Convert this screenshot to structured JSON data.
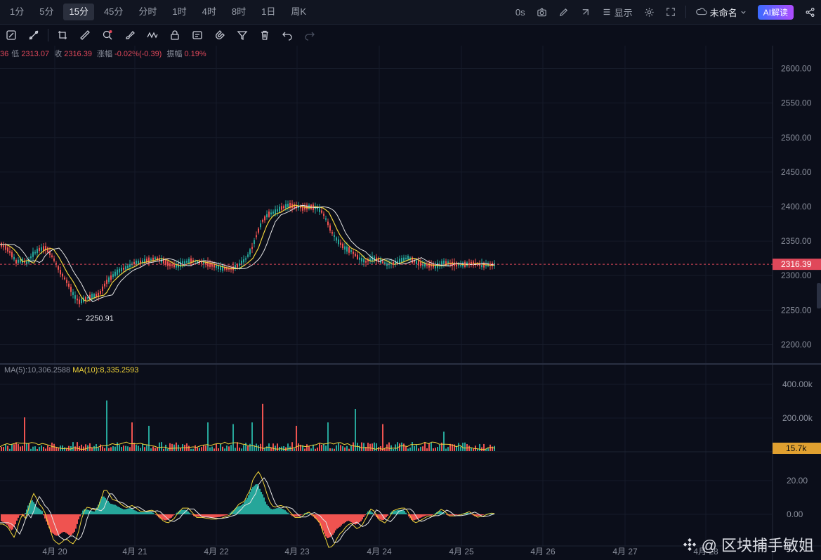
{
  "timeframes": [
    "1分",
    "5分",
    "15分",
    "45分",
    "分时",
    "1时",
    "4时",
    "8时",
    "1日",
    "周K"
  ],
  "active_timeframe": "15分",
  "toolbar_right": {
    "countdown": "0s",
    "display_label": "显示",
    "layout_name": "未命名",
    "ai_label": "AI解读"
  },
  "ohlc": {
    "prefix": "36",
    "low_label": "低",
    "low": "2313.07",
    "close_label": "收",
    "close": "2316.39",
    "change_label": "涨幅",
    "change": "-0.02%(-0.39)",
    "amp_label": "振幅",
    "amp": "0.19%"
  },
  "chart_data": {
    "type": "candlestick",
    "price_axis": {
      "ticks": [
        "2600.00",
        "2550.00",
        "2500.00",
        "2450.00",
        "2400.00",
        "2350.00",
        "2300.00",
        "2250.00",
        "2200.00"
      ],
      "range": [
        2175,
        2625
      ]
    },
    "current_price": "2316.39",
    "low_marker": "2250.91",
    "x_ticks": [
      "4月 20",
      "4月 21",
      "4月 22",
      "4月 23",
      "4月 24",
      "4月 25",
      "4月 26",
      "4月 27",
      "4月 28"
    ],
    "price_path": [
      [
        0,
        2345
      ],
      [
        8,
        2340
      ],
      [
        15,
        2332
      ],
      [
        22,
        2320
      ],
      [
        30,
        2322
      ],
      [
        38,
        2318
      ],
      [
        45,
        2330
      ],
      [
        55,
        2338
      ],
      [
        65,
        2340
      ],
      [
        75,
        2325
      ],
      [
        85,
        2305
      ],
      [
        95,
        2290
      ],
      [
        105,
        2270
      ],
      [
        112,
        2262
      ],
      [
        120,
        2266
      ],
      [
        130,
        2270
      ],
      [
        140,
        2272
      ],
      [
        150,
        2290
      ],
      [
        160,
        2300
      ],
      [
        170,
        2308
      ],
      [
        180,
        2312
      ],
      [
        190,
        2318
      ],
      [
        200,
        2320
      ],
      [
        210,
        2322
      ],
      [
        220,
        2325
      ],
      [
        230,
        2322
      ],
      [
        240,
        2316
      ],
      [
        250,
        2314
      ],
      [
        260,
        2318
      ],
      [
        270,
        2322
      ],
      [
        280,
        2320
      ],
      [
        290,
        2318
      ],
      [
        300,
        2315
      ],
      [
        310,
        2312
      ],
      [
        320,
        2310
      ],
      [
        330,
        2310
      ],
      [
        340,
        2316
      ],
      [
        350,
        2325
      ],
      [
        358,
        2340
      ],
      [
        365,
        2360
      ],
      [
        372,
        2378
      ],
      [
        380,
        2388
      ],
      [
        390,
        2392
      ],
      [
        400,
        2398
      ],
      [
        410,
        2402
      ],
      [
        420,
        2400
      ],
      [
        430,
        2398
      ],
      [
        440,
        2400
      ],
      [
        450,
        2398
      ],
      [
        458,
        2392
      ],
      [
        465,
        2378
      ],
      [
        472,
        2362
      ],
      [
        480,
        2350
      ],
      [
        490,
        2340
      ],
      [
        500,
        2335
      ],
      [
        510,
        2325
      ],
      [
        520,
        2320
      ],
      [
        530,
        2325
      ],
      [
        540,
        2322
      ],
      [
        550,
        2316
      ],
      [
        560,
        2318
      ],
      [
        570,
        2322
      ],
      [
        580,
        2326
      ],
      [
        590,
        2320
      ],
      [
        600,
        2316
      ],
      [
        610,
        2315
      ],
      [
        620,
        2314
      ],
      [
        630,
        2318
      ],
      [
        640,
        2317
      ],
      [
        650,
        2316
      ],
      [
        660,
        2316
      ],
      [
        670,
        2318
      ],
      [
        680,
        2316
      ],
      [
        690,
        2315
      ],
      [
        700,
        2316
      ],
      [
        705,
        2316
      ]
    ],
    "volume_legend": {
      "ma5": "MA(5):10,306.2588",
      "ma10": "MA(10):8,335.2593"
    },
    "volume_axis": {
      "ticks": [
        "400.00k",
        "200.00k"
      ],
      "current": "15.7k"
    },
    "volume_spikes": [
      [
        35,
        200
      ],
      [
        150,
        300
      ],
      [
        187,
        170
      ],
      [
        210,
        150
      ],
      [
        295,
        170
      ],
      [
        330,
        160
      ],
      [
        358,
        170
      ],
      [
        373,
        280
      ],
      [
        420,
        150
      ],
      [
        465,
        170
      ],
      [
        505,
        250
      ],
      [
        545,
        160
      ],
      [
        630,
        115
      ]
    ],
    "macd_axis": {
      "ticks": [
        "20.00",
        "0.00"
      ]
    }
  },
  "watermark": "@ 区块捕手敏姐",
  "colors": {
    "up": "#26a69a",
    "down": "#ef5350",
    "ma_yellow": "#f0d43a",
    "ma_white": "#e6e6e6",
    "price_tag": "#e0485a",
    "vol_tag": "#e0a030"
  }
}
